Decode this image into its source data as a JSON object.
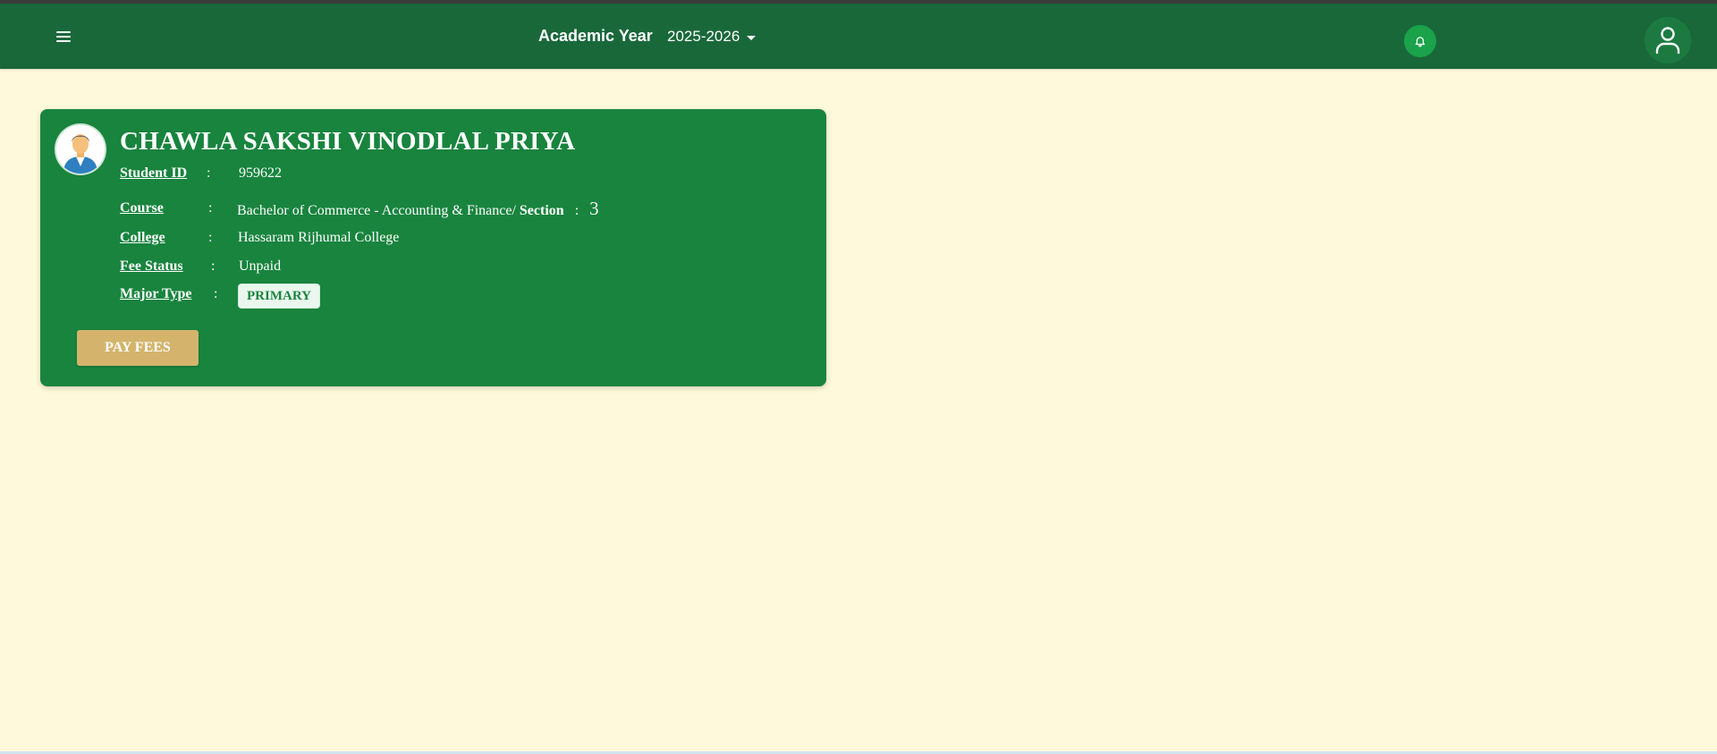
{
  "header": {
    "menu_icon": "hamburger-menu-icon",
    "academic_year_label": "Academic Year",
    "academic_year_value": "2025-2026",
    "notification_icon": "bell-icon",
    "profile_icon": "user-icon",
    "background_color": "#19683a"
  },
  "student_card": {
    "name": "CHAWLA SAKSHI VINODLAL PRIYA",
    "avatar_icon": "student-avatar-icon",
    "fields": {
      "student_id_label": "Student ID",
      "student_id_value": "959622",
      "course_label": "Course",
      "course_value": "Bachelor of Commerce - Accounting & Finance/",
      "section_label": "Section",
      "section_value": "3",
      "college_label": "College",
      "college_value": "Hassaram Rijhumal College",
      "fee_status_label": "Fee Status",
      "fee_status_value": "Unpaid",
      "major_type_label": "Major Type",
      "major_type_value": "PRIMARY"
    },
    "separator": ":",
    "pay_button_label": "PAY FEES",
    "card_color": "#18843e",
    "button_color": "#d4b46c"
  },
  "page": {
    "background_color": "#fff9db"
  }
}
